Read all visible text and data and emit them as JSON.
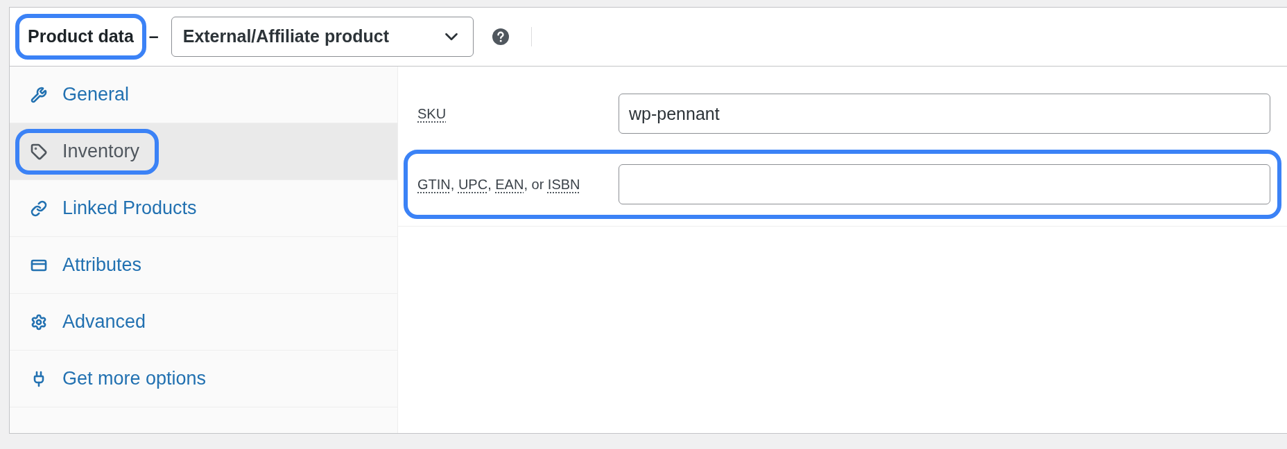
{
  "header": {
    "title": "Product data",
    "title_highlighted": true,
    "separator": "–",
    "product_type": "External/Affiliate product"
  },
  "tabs": [
    {
      "label": "General",
      "selected": false,
      "highlighted": false
    },
    {
      "label": "Inventory",
      "selected": true,
      "highlighted": true
    },
    {
      "label": "Linked Products",
      "selected": false,
      "highlighted": false
    },
    {
      "label": "Attributes",
      "selected": false,
      "highlighted": false
    },
    {
      "label": "Advanced",
      "selected": false,
      "highlighted": false
    },
    {
      "label": "Get more options",
      "selected": false,
      "highlighted": false
    }
  ],
  "fields": [
    {
      "label": [
        {
          "text": "SKU",
          "abbr": true
        }
      ],
      "value": "wp-pennant",
      "highlighted": false
    },
    {
      "label": [
        {
          "text": "GTIN",
          "abbr": true
        },
        {
          "text": ", ",
          "abbr": false
        },
        {
          "text": "UPC",
          "abbr": true
        },
        {
          "text": ", ",
          "abbr": false
        },
        {
          "text": "EAN",
          "abbr": true
        },
        {
          "text": ", or ",
          "abbr": false
        },
        {
          "text": "ISBN",
          "abbr": true
        }
      ],
      "highlighted": true
    }
  ]
}
